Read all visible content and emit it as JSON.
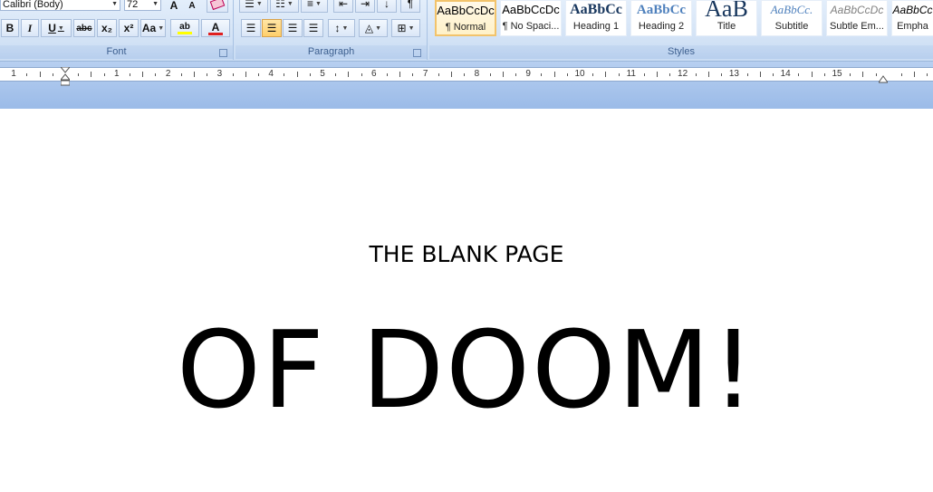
{
  "font": {
    "name": "Calibri (Body)",
    "size": "72",
    "label": "Font",
    "buttons": {
      "grow": "A",
      "shrink": "A",
      "bold": "B",
      "italic": "I",
      "underline": "U",
      "strike": "abc",
      "subscript": "x₂",
      "superscript": "x²",
      "case": "Aa",
      "highlight": "ab",
      "font_color": "A"
    }
  },
  "paragraph": {
    "label": "Paragraph"
  },
  "styles": {
    "label": "Styles",
    "items": [
      {
        "sample": "AaBbCcDc",
        "name": "¶ Normal"
      },
      {
        "sample": "AaBbCcDc",
        "name": "¶ No Spaci..."
      },
      {
        "sample": "AaBbCc",
        "name": "Heading 1"
      },
      {
        "sample": "AaBbCc",
        "name": "Heading 2"
      },
      {
        "sample": "AaB",
        "name": "Title"
      },
      {
        "sample": "AaBbCc.",
        "name": "Subtitle"
      },
      {
        "sample": "AaBbCcDc",
        "name": "Subtle Em..."
      },
      {
        "sample": "AaBbCc",
        "name": "Empha"
      }
    ]
  },
  "ruler": {
    "numbers": [
      "1",
      "1",
      "2",
      "3",
      "4",
      "5",
      "6",
      "7",
      "8",
      "9",
      "10",
      "11",
      "12",
      "13",
      "14",
      "15"
    ]
  },
  "document": {
    "line1": "THE BLANK PAGE",
    "line2": "OF DOOM!"
  },
  "colors": {
    "ribbon": "#d5e4f6",
    "font_color_bar": "#e02020",
    "highlight_bar": "#ffff00"
  }
}
